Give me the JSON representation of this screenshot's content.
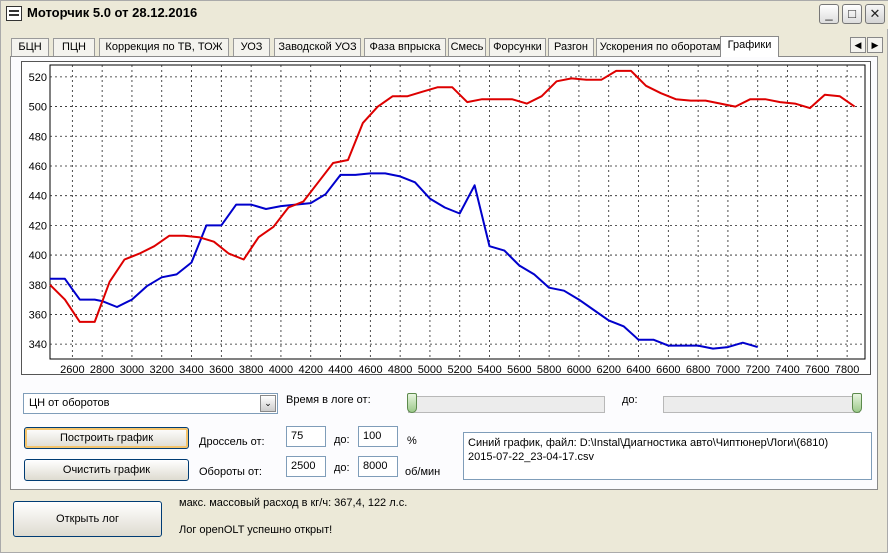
{
  "window": {
    "title": "Моторчик 5.0 от 28.12.2016",
    "minimize": "_",
    "maximize": "□",
    "close": "✕"
  },
  "tabs": [
    {
      "label": "БЦН"
    },
    {
      "label": "ПЦН"
    },
    {
      "label": "Коррекция по ТВ, ТОЖ"
    },
    {
      "label": "УОЗ"
    },
    {
      "label": "Заводской УОЗ"
    },
    {
      "label": "Фаза впрыска"
    },
    {
      "label": "Смесь"
    },
    {
      "label": "Форсунки"
    },
    {
      "label": "Разгон"
    },
    {
      "label": "Ускорения по оборотам"
    },
    {
      "label": "Графики"
    }
  ],
  "tab_scroll": {
    "left": "◀",
    "right": "▶"
  },
  "chart_data": {
    "type": "line",
    "xlim": [
      2450,
      7920
    ],
    "ylim": [
      330,
      528
    ],
    "x_ticks": [
      2600,
      2800,
      3000,
      3200,
      3400,
      3600,
      3800,
      4000,
      4200,
      4400,
      4600,
      4800,
      5000,
      5200,
      5400,
      5600,
      5800,
      6000,
      6200,
      6400,
      6600,
      6800,
      7000,
      7200,
      7400,
      7600,
      7800
    ],
    "y_ticks": [
      340,
      360,
      380,
      400,
      420,
      440,
      460,
      480,
      500,
      520
    ],
    "grid": true,
    "series": [
      {
        "color": "#0000cc",
        "points": [
          [
            2450,
            384
          ],
          [
            2550,
            384
          ],
          [
            2600,
            377
          ],
          [
            2650,
            370
          ],
          [
            2750,
            370
          ],
          [
            2800,
            369
          ],
          [
            2900,
            365
          ],
          [
            3000,
            370
          ],
          [
            3100,
            379
          ],
          [
            3200,
            385
          ],
          [
            3300,
            387
          ],
          [
            3400,
            395
          ],
          [
            3500,
            420
          ],
          [
            3600,
            420
          ],
          [
            3700,
            434
          ],
          [
            3800,
            434
          ],
          [
            3900,
            431
          ],
          [
            4000,
            433
          ],
          [
            4100,
            434
          ],
          [
            4200,
            435
          ],
          [
            4300,
            441
          ],
          [
            4400,
            454
          ],
          [
            4500,
            454
          ],
          [
            4600,
            455
          ],
          [
            4700,
            455
          ],
          [
            4800,
            453
          ],
          [
            4900,
            449
          ],
          [
            5000,
            438
          ],
          [
            5100,
            432
          ],
          [
            5200,
            428
          ],
          [
            5300,
            447
          ],
          [
            5400,
            406
          ],
          [
            5500,
            403
          ],
          [
            5600,
            393
          ],
          [
            5700,
            387
          ],
          [
            5800,
            378
          ],
          [
            5900,
            376
          ],
          [
            6000,
            370
          ],
          [
            6100,
            363
          ],
          [
            6200,
            356
          ],
          [
            6300,
            352
          ],
          [
            6400,
            343
          ],
          [
            6500,
            343
          ],
          [
            6600,
            339
          ],
          [
            6700,
            339
          ],
          [
            6800,
            339
          ],
          [
            6900,
            337
          ],
          [
            7000,
            338
          ],
          [
            7100,
            341
          ],
          [
            7200,
            338
          ]
        ]
      },
      {
        "color": "#dd0000",
        "points": [
          [
            2450,
            380
          ],
          [
            2550,
            370
          ],
          [
            2650,
            355
          ],
          [
            2750,
            355
          ],
          [
            2850,
            382
          ],
          [
            2950,
            397
          ],
          [
            3050,
            401
          ],
          [
            3150,
            406
          ],
          [
            3250,
            413
          ],
          [
            3350,
            413
          ],
          [
            3450,
            412
          ],
          [
            3550,
            409
          ],
          [
            3650,
            401
          ],
          [
            3750,
            397
          ],
          [
            3850,
            412
          ],
          [
            3950,
            419
          ],
          [
            4050,
            432
          ],
          [
            4150,
            436
          ],
          [
            4250,
            449
          ],
          [
            4350,
            462
          ],
          [
            4450,
            464
          ],
          [
            4550,
            489
          ],
          [
            4650,
            500
          ],
          [
            4750,
            507
          ],
          [
            4850,
            507
          ],
          [
            4950,
            510
          ],
          [
            5050,
            513
          ],
          [
            5150,
            513
          ],
          [
            5250,
            503
          ],
          [
            5350,
            505
          ],
          [
            5450,
            505
          ],
          [
            5550,
            505
          ],
          [
            5650,
            502
          ],
          [
            5750,
            507
          ],
          [
            5850,
            517
          ],
          [
            5950,
            519
          ],
          [
            6050,
            518
          ],
          [
            6150,
            518
          ],
          [
            6250,
            524
          ],
          [
            6350,
            524
          ],
          [
            6450,
            514
          ],
          [
            6550,
            509
          ],
          [
            6650,
            505
          ],
          [
            6750,
            504
          ],
          [
            6850,
            504
          ],
          [
            6950,
            502
          ],
          [
            7050,
            500
          ],
          [
            7150,
            505
          ],
          [
            7250,
            505
          ],
          [
            7350,
            503
          ],
          [
            7450,
            502
          ],
          [
            7550,
            499
          ],
          [
            7650,
            508
          ],
          [
            7750,
            507
          ],
          [
            7850,
            500
          ]
        ]
      }
    ]
  },
  "controls": {
    "graph_type_value": "ЦН от оборотов",
    "combo_arrow": "⌄",
    "log_time_label": "Время в логе от:",
    "to_label": "до:",
    "build_button": "Построить график",
    "clear_button": "Очистить график",
    "throttle_label": "Дроссель от:",
    "throttle_from": "75",
    "throttle_to_label": "до:",
    "throttle_to": "100",
    "throttle_unit": "%",
    "rpm_label": "Обороты от:",
    "rpm_from": "2500",
    "rpm_to_label": "до:",
    "rpm_to": "8000",
    "rpm_unit": "об/мин",
    "memo_line1": "Синий график, файл: D:\\Instal\\Диагностика авто\\Чиптюнер\\Логи\\(6810)",
    "memo_line2": "2015-07-22_23-04-17.csv"
  },
  "bottom": {
    "open_log_button": "Открыть лог",
    "max_flow_text": "макс. массовый расход в кг/ч: 367,4, 122 л.с.",
    "log_status": "Лог openOLT успешно открыт!"
  },
  "colors": {
    "blue_series": "#0000cc",
    "red_series": "#dd0000",
    "window_bg": "#ece9d8"
  }
}
